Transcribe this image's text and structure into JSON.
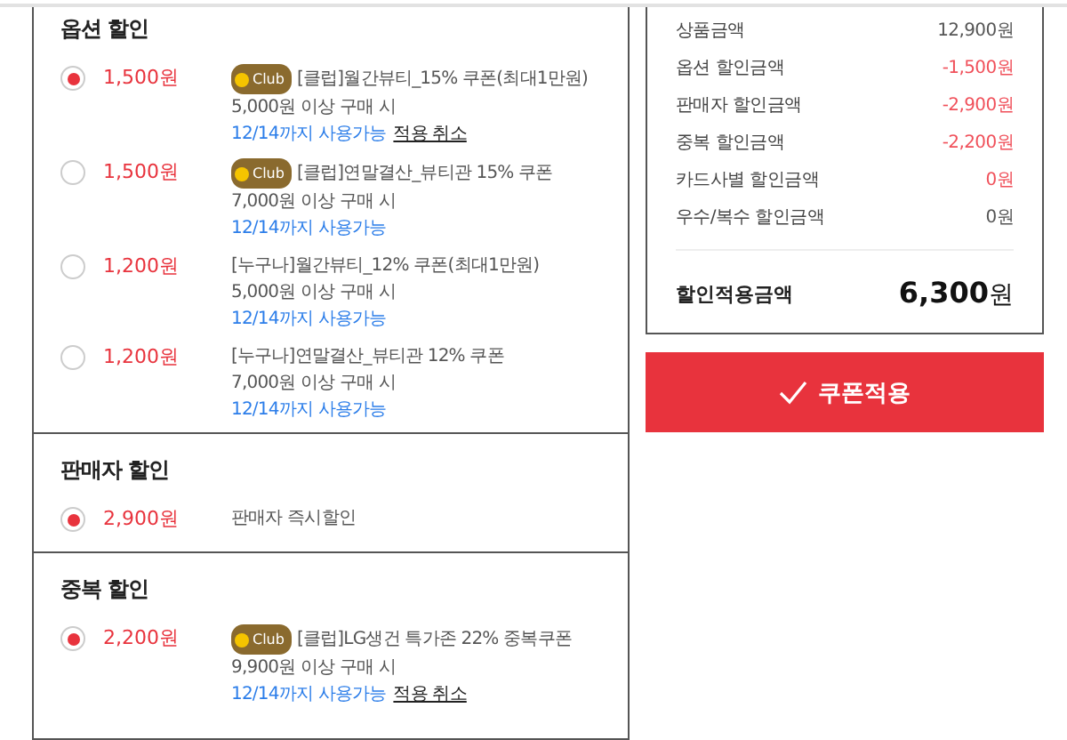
{
  "sections": [
    {
      "title": "옵션 할인",
      "items": [
        {
          "selected": true,
          "amount": "1,500원",
          "club": true,
          "club_label": "Club",
          "name": "[클럽]월간뷰티_15% 쿠폰(최대1만원)",
          "condition": "5,000원 이상 구매 시",
          "validity": "12/14까지 사용가능",
          "cancel": "적용 취소"
        },
        {
          "selected": false,
          "amount": "1,500원",
          "club": true,
          "club_label": "Club",
          "name": "[클럽]연말결산_뷰티관 15% 쿠폰",
          "condition": "7,000원 이상 구매 시",
          "validity": "12/14까지 사용가능"
        },
        {
          "selected": false,
          "amount": "1,200원",
          "club": false,
          "name": "[누구나]월간뷰티_12% 쿠폰(최대1만원)",
          "condition": "5,000원 이상 구매 시",
          "validity": "12/14까지 사용가능"
        },
        {
          "selected": false,
          "amount": "1,200원",
          "club": false,
          "name": "[누구나]연말결산_뷰티관 12% 쿠폰",
          "condition": "7,000원 이상 구매 시",
          "validity": "12/14까지 사용가능"
        }
      ]
    },
    {
      "title": "판매자 할인",
      "items": [
        {
          "selected": true,
          "amount": "2,900원",
          "club": false,
          "name": "판매자 즉시할인"
        }
      ]
    },
    {
      "title": "중복 할인",
      "items": [
        {
          "selected": true,
          "amount": "2,200원",
          "club": true,
          "club_label": "Club",
          "name": "[클럽]LG생건 특가존 22% 중복쿠폰",
          "condition": "9,900원 이상 구매 시",
          "validity": "12/14까지 사용가능",
          "cancel": "적용 취소"
        }
      ]
    }
  ],
  "summary": {
    "rows": [
      {
        "label": "상품금액",
        "value": "12,900원",
        "kind": "plain"
      },
      {
        "label": "옵션 할인금액",
        "value": "-1,500원",
        "kind": "discount"
      },
      {
        "label": "판매자 할인금액",
        "value": "-2,900원",
        "kind": "discount"
      },
      {
        "label": "중복 할인금액",
        "value": "-2,200원",
        "kind": "discount"
      },
      {
        "label": "카드사별 할인금액",
        "value": "0원",
        "kind": "discount"
      },
      {
        "label": "우수/복수 할인금액",
        "value": "0원",
        "kind": "plain"
      }
    ],
    "total_label": "할인적용금액",
    "total_number": "6,300",
    "total_unit": "원"
  },
  "apply_button": "쿠폰적용"
}
